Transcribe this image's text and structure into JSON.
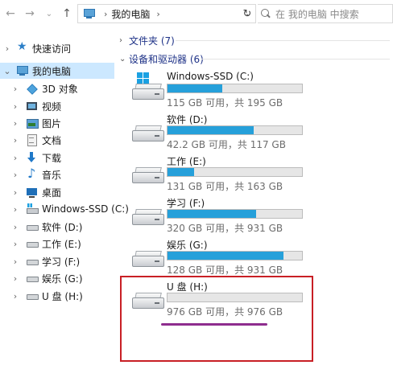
{
  "address": {
    "location": "我的电脑",
    "search_placeholder": "在 我的电脑 中搜索"
  },
  "sidebar": {
    "items": [
      {
        "label": "快速访问",
        "icon": "star-icon"
      },
      {
        "label": "我的电脑",
        "icon": "computer-icon"
      },
      {
        "label": "3D 对象",
        "icon": "3d-objects-icon"
      },
      {
        "label": "视频",
        "icon": "video-icon"
      },
      {
        "label": "图片",
        "icon": "pictures-icon"
      },
      {
        "label": "文档",
        "icon": "documents-icon"
      },
      {
        "label": "下载",
        "icon": "download-icon"
      },
      {
        "label": "音乐",
        "icon": "music-icon"
      },
      {
        "label": "桌面",
        "icon": "desktop-icon"
      },
      {
        "label": "Windows-SSD (C:)",
        "icon": "windows-drive-icon"
      },
      {
        "label": "软件 (D:)",
        "icon": "drive-icon"
      },
      {
        "label": "工作 (E:)",
        "icon": "drive-icon"
      },
      {
        "label": "学习 (F:)",
        "icon": "drive-icon"
      },
      {
        "label": "娱乐 (G:)",
        "icon": "drive-icon"
      },
      {
        "label": "U 盘 (H:)",
        "icon": "drive-icon"
      }
    ]
  },
  "main": {
    "folders_header": "文件夹 (7)",
    "devices_header": "设备和驱动器 (6)",
    "drives": [
      {
        "name": "Windows-SSD (C:)",
        "info": "115 GB 可用，共 195 GB",
        "used_fraction": 0.41,
        "system": true
      },
      {
        "name": "软件 (D:)",
        "info": "42.2 GB 可用，共 117 GB",
        "used_fraction": 0.64,
        "system": false
      },
      {
        "name": "工作 (E:)",
        "info": "131 GB 可用，共 163 GB",
        "used_fraction": 0.2,
        "system": false
      },
      {
        "name": "学习 (F:)",
        "info": "320 GB 可用，共 931 GB",
        "used_fraction": 0.66,
        "system": false
      },
      {
        "name": "娱乐 (G:)",
        "info": "128 GB 可用，共 931 GB",
        "used_fraction": 0.86,
        "system": false
      },
      {
        "name": "U 盘 (H:)",
        "info": "976 GB 可用，共 976 GB",
        "used_fraction": 0.0,
        "system": false
      }
    ]
  },
  "colors": {
    "bar_fill": "#26a0da",
    "selected_bg": "#cce8ff",
    "highlight_border": "#c81f25",
    "underline_mark": "#8e2d8e"
  }
}
